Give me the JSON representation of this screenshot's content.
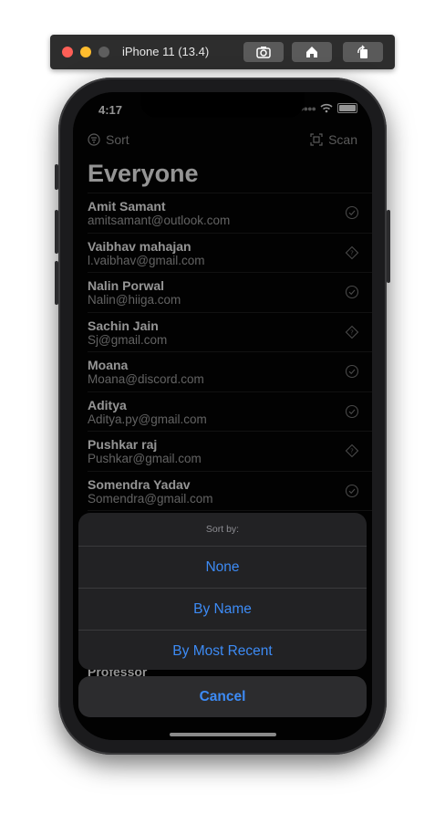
{
  "simulator": {
    "title": "iPhone 11 (13.4)",
    "buttons": [
      "screenshot-icon",
      "home-icon",
      "rotate-icon"
    ]
  },
  "status_bar": {
    "time": "4:17"
  },
  "nav": {
    "sort_label": "Sort",
    "scan_label": "Scan"
  },
  "page_title": "Everyone",
  "contacts": [
    {
      "name": "Amit Samant",
      "email": "amitsamant@outlook.com",
      "status_icon": "check-circle-icon"
    },
    {
      "name": "Vaibhav mahajan",
      "email": "l.vaibhav@gmail.com",
      "status_icon": "diamond-question-icon"
    },
    {
      "name": "Nalin Porwal",
      "email": "Nalin@hiiga.com",
      "status_icon": "check-circle-icon"
    },
    {
      "name": "Sachin Jain",
      "email": "Sj@gmail.com",
      "status_icon": "diamond-question-icon"
    },
    {
      "name": "Moana",
      "email": "Moana@discord.com",
      "status_icon": "check-circle-icon"
    },
    {
      "name": "Aditya",
      "email": "Aditya.py@gmail.com",
      "status_icon": "check-circle-icon"
    },
    {
      "name": "Pushkar raj",
      "email": "Pushkar@gmail.com",
      "status_icon": "diamond-question-icon"
    },
    {
      "name": "Somendra Yadav",
      "email": "Somendra@gmail.com",
      "status_icon": "check-circle-icon"
    }
  ],
  "partial_row": {
    "name": "Professor"
  },
  "action_sheet": {
    "title": "Sort by:",
    "options": [
      "None",
      "By Name",
      "By Most Recent"
    ],
    "cancel": "Cancel"
  },
  "colors": {
    "accent": "#3d8bf5",
    "background": "#050505",
    "sheet": "#222224"
  }
}
